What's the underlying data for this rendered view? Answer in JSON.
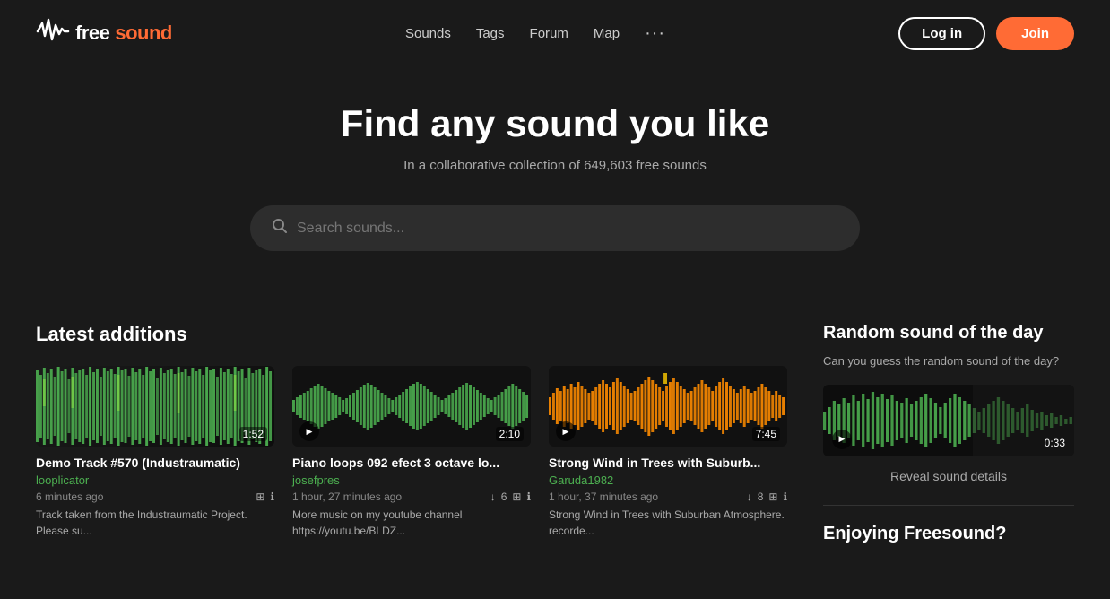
{
  "header": {
    "logo_text_free": "free",
    "logo_text_sound": "sound",
    "nav": {
      "sounds": "Sounds",
      "tags": "Tags",
      "forum": "Forum",
      "map": "Map",
      "more": "···"
    },
    "login_label": "Log in",
    "join_label": "Join"
  },
  "hero": {
    "title": "Find any sound you like",
    "subtitle": "In a collaborative collection of 649,603 free sounds",
    "search_placeholder": "Search sounds..."
  },
  "latest_additions": {
    "section_title": "Latest additions",
    "cards": [
      {
        "title": "Demo Track #570 (Industraumatic",
        "title_full": "Demo Track #570 (Industraumatic)",
        "author": "looplicator",
        "time": "6 minutes ago",
        "duration": "1:52",
        "description": "Track taken from the Industraumatic Project. Please su...",
        "downloads": null,
        "waveform_type": "green_dense"
      },
      {
        "title": "Piano loops 092 efect 3 octave lo...",
        "title_full": "Piano loops 092 efect 3 octave lo...",
        "author": "josefpres",
        "time": "1 hour, 27 minutes ago",
        "duration": "2:10",
        "downloads": "6",
        "description": "More music on my youtube channel https://youtu.be/BLDZ...",
        "waveform_type": "green_flat"
      },
      {
        "title": "Strong Wind in Trees with Suburb...",
        "title_full": "Strong Wind in Trees with Suburb...",
        "author": "Garuda1982",
        "time": "1 hour, 37 minutes ago",
        "duration": "7:45",
        "downloads": "8",
        "description": "Strong Wind in Trees with Suburban Atmosphere. recorde...",
        "waveform_type": "orange"
      }
    ]
  },
  "sidebar": {
    "random_title": "Random sound of the day",
    "random_subtitle": "Can you guess the random sound of the day?",
    "random_duration": "0:33",
    "reveal_label": "Reveal sound details",
    "enjoying_title": "Enjoying Freesound?"
  }
}
